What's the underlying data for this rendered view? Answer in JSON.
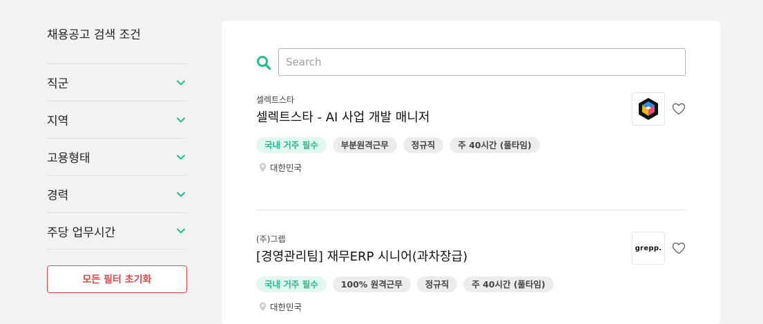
{
  "sidebar": {
    "title": "채용공고 검색 조건",
    "filters": [
      {
        "label": "직군"
      },
      {
        "label": "지역"
      },
      {
        "label": "고용형태"
      },
      {
        "label": "경력"
      },
      {
        "label": "주당 업무시간"
      }
    ],
    "reset_label": "모든 필터 초기화"
  },
  "search": {
    "placeholder": "Search",
    "icon": "search-icon"
  },
  "jobs": [
    {
      "company": "셀렉트스타",
      "title": "셀렉트스타 - AI 사업 개발 매니저",
      "tags": [
        "국내 거주 필수",
        "부분원격근무",
        "정규직",
        "주 40시간 (풀타임)"
      ],
      "location": "대한민국",
      "logo_icon": "selectstar-logo"
    },
    {
      "company": "(주)그렙",
      "title": "[경영관리팀] 재무ERP 시니어(과차장급)",
      "tags": [
        "국내 거주 필수",
        "100% 원격근무",
        "정규직",
        "주 40시간 (풀타임)"
      ],
      "location": "대한민국",
      "logo_text": "grepp."
    }
  ],
  "colors": {
    "accent": "#1cbf8e",
    "danger": "#e04848",
    "tag_green_bg": "#e1f8f0"
  }
}
